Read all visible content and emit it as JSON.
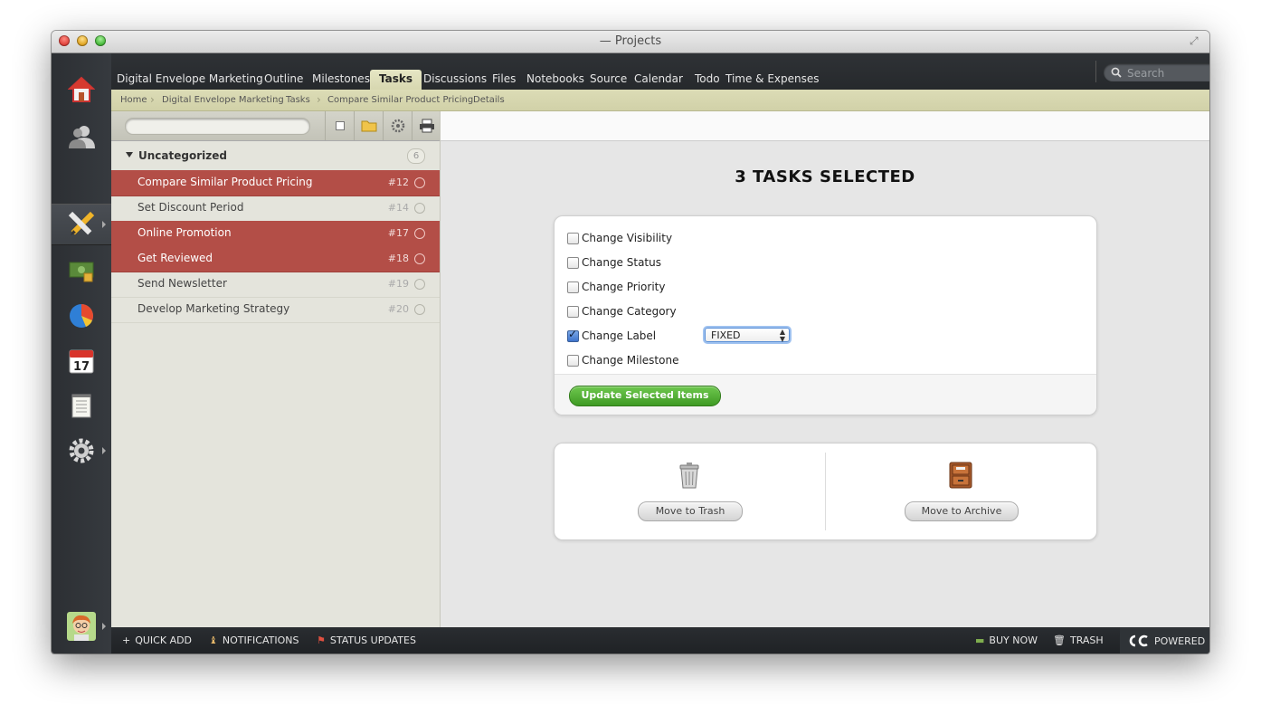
{
  "window": {
    "title": "— Projects"
  },
  "sidebar": {
    "items": [
      {
        "icon": "home-icon"
      },
      {
        "icon": "people-icon"
      },
      {
        "icon": "pencil-tools-icon",
        "active": true
      },
      {
        "icon": "money-icon"
      },
      {
        "icon": "pie-chart-icon"
      },
      {
        "icon": "calendar-icon",
        "day": "17"
      },
      {
        "icon": "notepad-icon"
      },
      {
        "icon": "gear-icon"
      }
    ],
    "avatar": "user-avatar"
  },
  "nav": {
    "project": "Digital Envelope Marketing",
    "tabs": [
      "Outline",
      "Milestones",
      "Tasks",
      "Discussions",
      "Files",
      "Notebooks",
      "Source",
      "Calendar",
      "Todo",
      "Time & Expenses"
    ],
    "active_tab": "Tasks",
    "search_placeholder": "Search"
  },
  "breadcrumb": [
    "Home",
    "Digital Envelope Marketing",
    "Tasks",
    "Compare Similar Product Pricing",
    "Details"
  ],
  "tasklist": {
    "group": "Uncategorized",
    "count": "6",
    "tasks": [
      {
        "name": "Compare Similar Product Pricing",
        "num": "#12",
        "selected": true
      },
      {
        "name": "Set Discount Period",
        "num": "#14",
        "selected": false
      },
      {
        "name": "Online Promotion",
        "num": "#17",
        "selected": true
      },
      {
        "name": "Get Reviewed",
        "num": "#18",
        "selected": true
      },
      {
        "name": "Send Newsletter",
        "num": "#19",
        "selected": false
      },
      {
        "name": "Develop Marketing Strategy",
        "num": "#20",
        "selected": false
      }
    ]
  },
  "detail": {
    "title": "3 TASKS SELECTED",
    "options": [
      {
        "label": "Change Visibility",
        "checked": false
      },
      {
        "label": "Change Status",
        "checked": false
      },
      {
        "label": "Change Priority",
        "checked": false
      },
      {
        "label": "Change Category",
        "checked": false
      },
      {
        "label": "Change Label",
        "checked": true
      },
      {
        "label": "Change Milestone",
        "checked": false
      }
    ],
    "label_value": "FIXED",
    "update_button": "Update Selected Items",
    "trash_button": "Move to Trash",
    "archive_button": "Move to Archive"
  },
  "bottombar": {
    "quick_add": "QUICK ADD",
    "notifications": "NOTIFICATIONS",
    "status_updates": "STATUS UPDATES",
    "buy_now": "BUY NOW",
    "trash": "TRASH",
    "powered": "POWERED"
  },
  "colors": {
    "selected_row": "#b34e47",
    "update_button": "#4fa82f",
    "breadcrumb_bg": "#d6d6ad",
    "dark_chrome": "#2c2f33"
  }
}
